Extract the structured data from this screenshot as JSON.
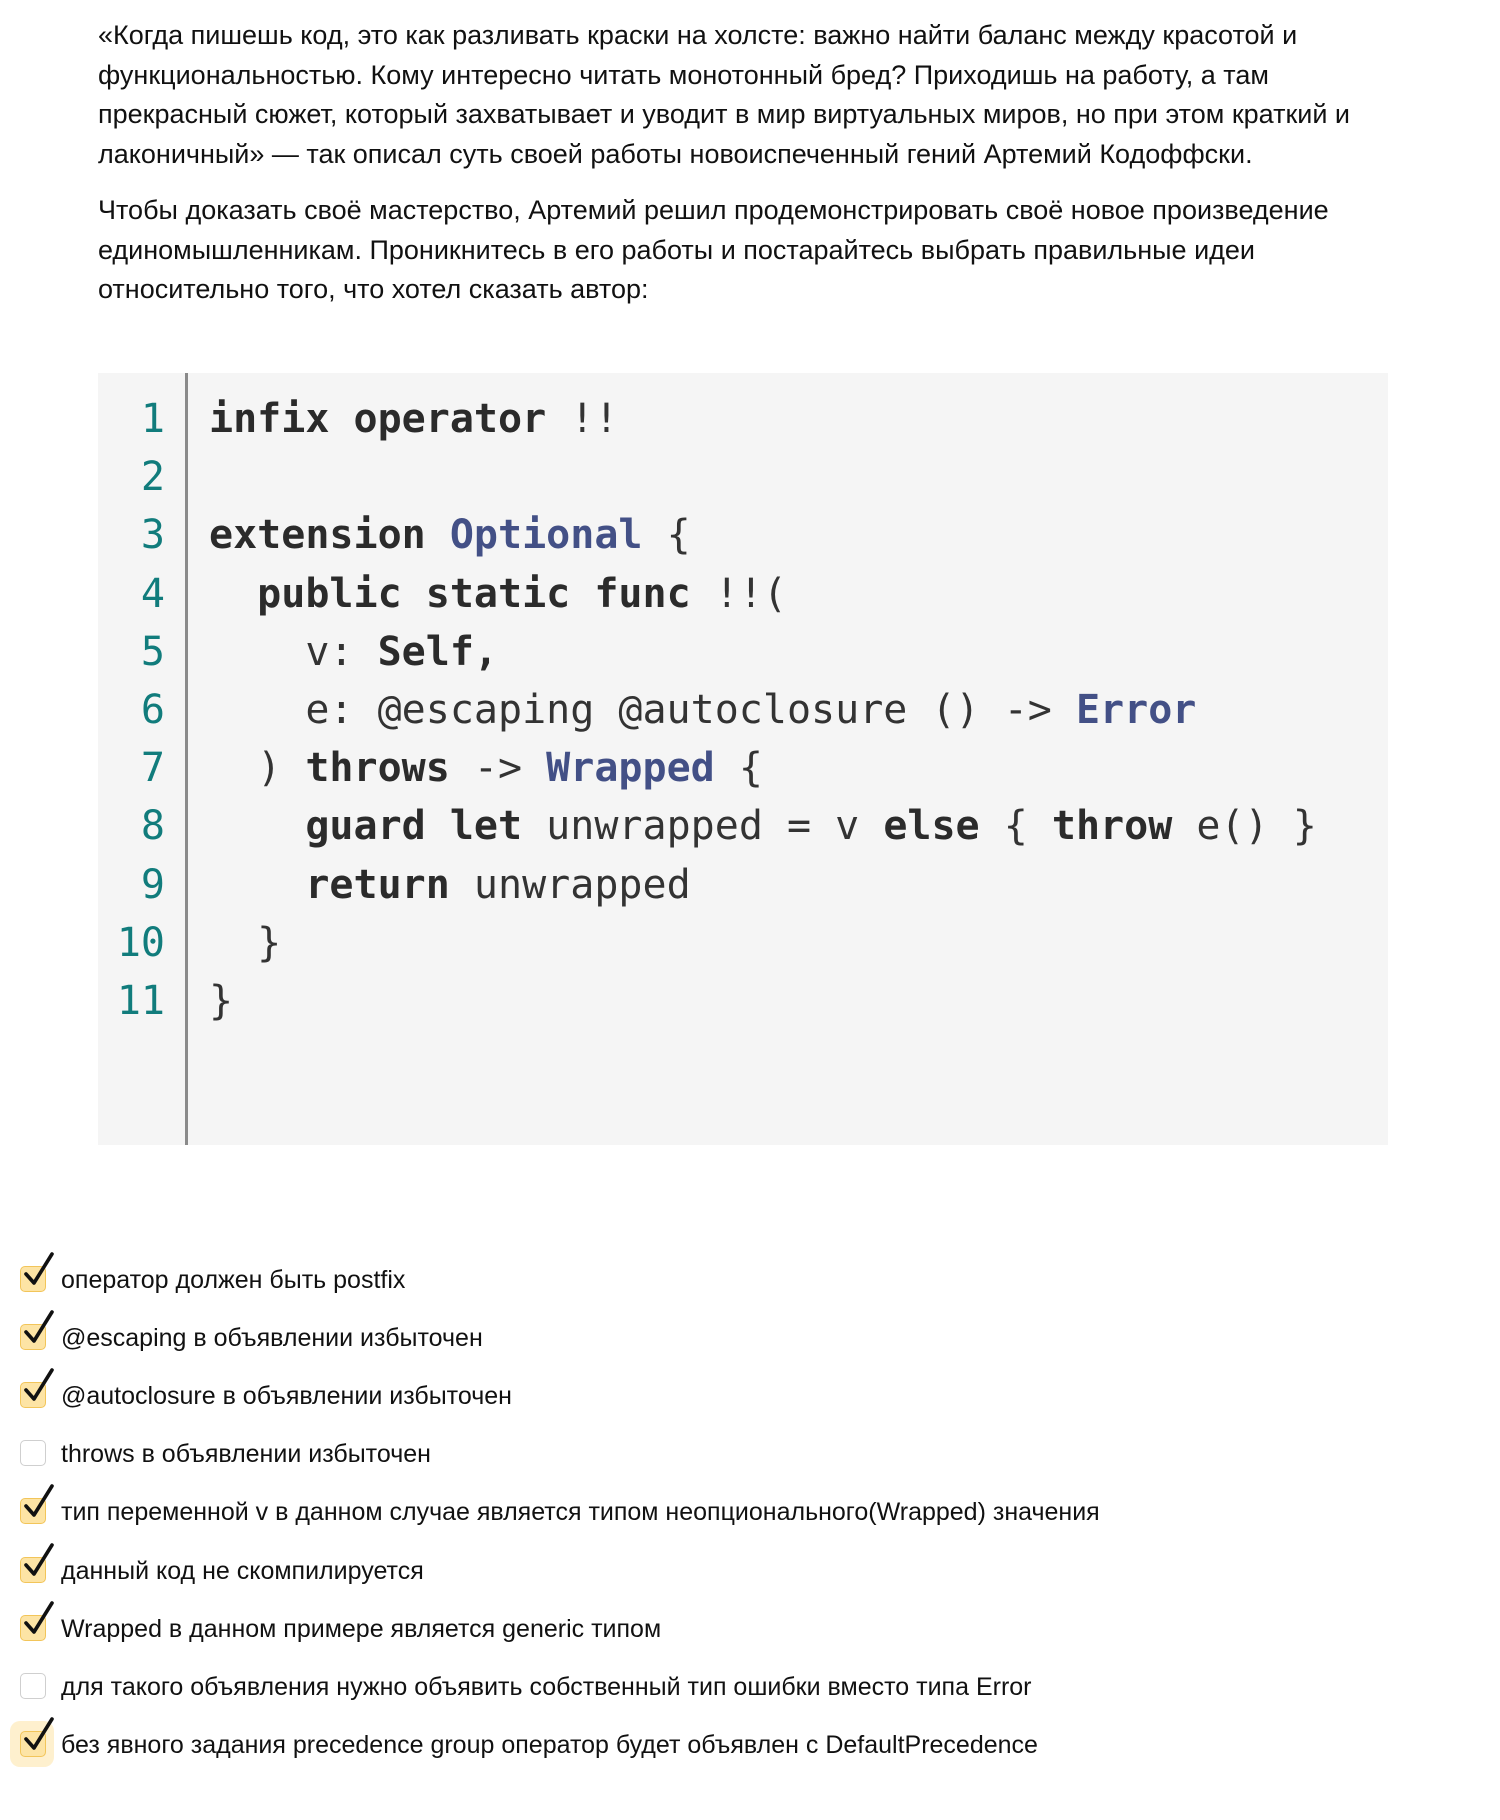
{
  "intro": {
    "paragraph1": "«Когда пишешь код, это как разливать краски на холсте: важно найти баланс между красотой и функциональностью. Кому интересно читать монотонный бред? Приходишь на работу, а там прекрасный сюжет, который захватывает и уводит в мир виртуальных миров, но при этом краткий и лаконичный» — так описал суть своей работы новоиспеченный гений Артемий Кодоффски.",
    "paragraph2": "Чтобы доказать своё мастерство, Артемий решил продемонстрировать своё новое произведение единомышленникам. Проникнитесь в его работы и постарайтесь выбрать правильные идеи относительно того, что хотел сказать автор:"
  },
  "code": {
    "line_numbers": [
      "1",
      "2",
      "3",
      "4",
      "5",
      "6",
      "7",
      "8",
      "9",
      "10",
      "11"
    ],
    "lines": [
      [
        {
          "t": "infix operator",
          "c": "kw"
        },
        {
          "t": " !!",
          "c": "pl"
        }
      ],
      [],
      [
        {
          "t": "extension",
          "c": "kw"
        },
        {
          "t": " ",
          "c": "pl"
        },
        {
          "t": "Optional",
          "c": "ty"
        },
        {
          "t": " {",
          "c": "pl"
        }
      ],
      [
        {
          "t": "  ",
          "c": "pl"
        },
        {
          "t": "public static func",
          "c": "kw"
        },
        {
          "t": " !!(",
          "c": "pl"
        }
      ],
      [
        {
          "t": "    v: ",
          "c": "pl"
        },
        {
          "t": "Self",
          "c": "kw"
        },
        {
          "t": ",",
          "c": "kw"
        }
      ],
      [
        {
          "t": "    e: @escaping @autoclosure () -> ",
          "c": "pl"
        },
        {
          "t": "Error",
          "c": "ty"
        }
      ],
      [
        {
          "t": "  ) ",
          "c": "pl"
        },
        {
          "t": "throws",
          "c": "kw"
        },
        {
          "t": " -> ",
          "c": "pl"
        },
        {
          "t": "Wrapped",
          "c": "ty"
        },
        {
          "t": " {",
          "c": "pl"
        }
      ],
      [
        {
          "t": "    ",
          "c": "pl"
        },
        {
          "t": "guard let",
          "c": "kw"
        },
        {
          "t": " unwrapped = v ",
          "c": "pl"
        },
        {
          "t": "else",
          "c": "kw"
        },
        {
          "t": " { ",
          "c": "pl"
        },
        {
          "t": "throw",
          "c": "kw"
        },
        {
          "t": " e() }",
          "c": "pl"
        }
      ],
      [
        {
          "t": "    ",
          "c": "pl"
        },
        {
          "t": "return",
          "c": "kw"
        },
        {
          "t": " unwrapped",
          "c": "pl"
        }
      ],
      [
        {
          "t": "  }",
          "c": "pl"
        }
      ],
      [
        {
          "t": "}",
          "c": "pl"
        }
      ]
    ]
  },
  "options": [
    {
      "label": "оператор должен быть postfix",
      "checked": true
    },
    {
      "label": "@escaping в объявлении избыточен",
      "checked": true
    },
    {
      "label": "@autoclosure в объявлении избыточен",
      "checked": true
    },
    {
      "label": "throws в объявлении избыточен",
      "checked": false
    },
    {
      "label": "тип переменной v в данном случае является типом неопционального(Wrapped) значения",
      "checked": true
    },
    {
      "label": "данный код не скомпилируется",
      "checked": true
    },
    {
      "label": "Wrapped в данном примере является generic типом",
      "checked": true
    },
    {
      "label": "для такого объявления нужно объявить собственный тип ошибки вместо типа Error",
      "checked": false
    },
    {
      "label": "без явного задания precedence group оператор будет объявлен с DefaultPrecedence",
      "checked": true
    }
  ],
  "colors": {
    "line_number": "#117c7c",
    "type": "#435086",
    "checkbox_fill": "#fde4a5",
    "checkbox_border": "#f2c55a"
  }
}
